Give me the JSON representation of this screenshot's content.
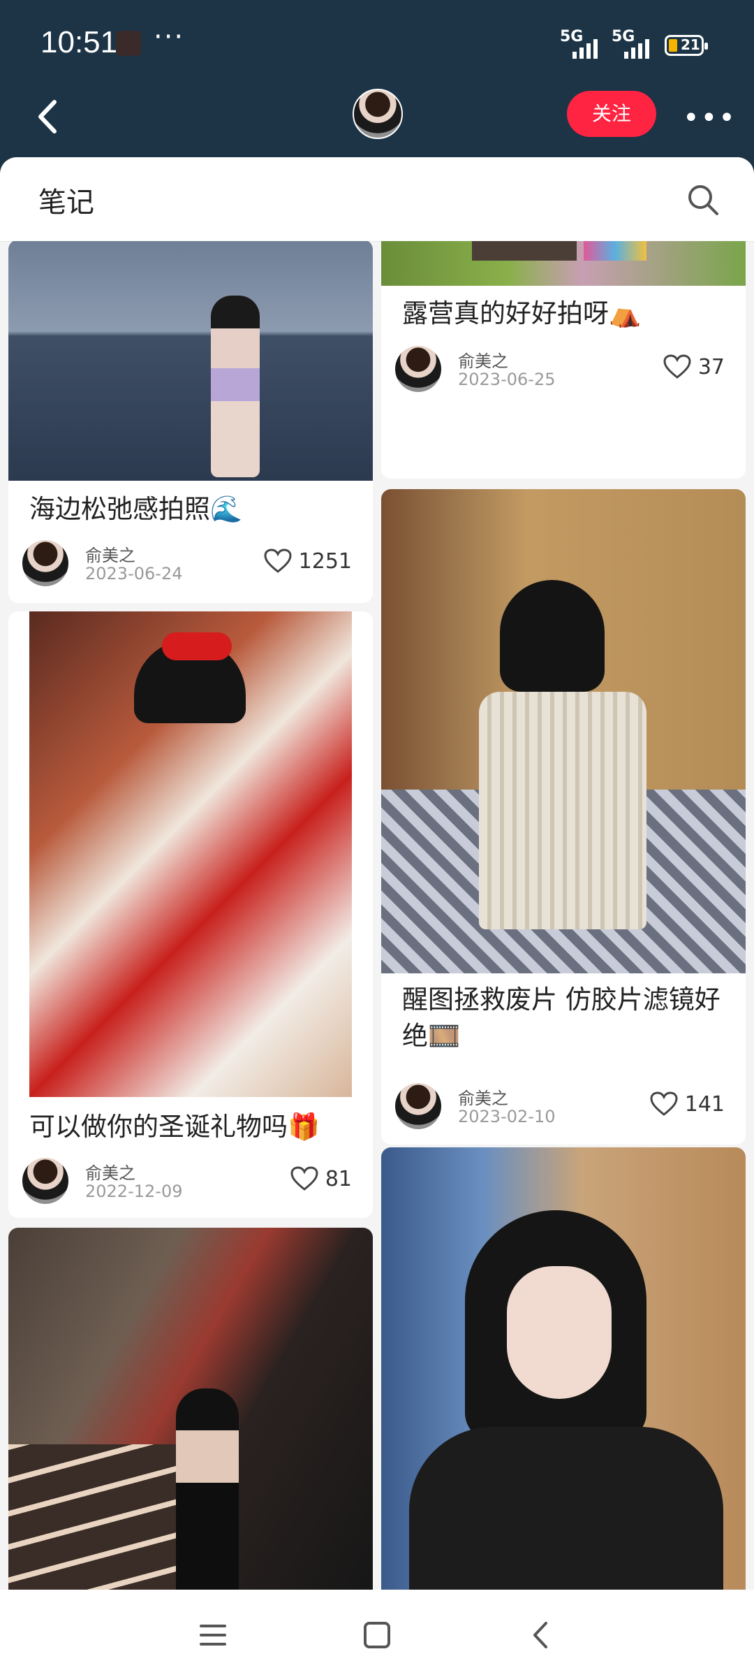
{
  "status_bar": {
    "time": "10:51",
    "network_1": "5G",
    "network_2": "5G",
    "battery": "21"
  },
  "top_bar": {
    "follow_label": "关注"
  },
  "section": {
    "title": "笔记"
  },
  "notes": [
    {
      "title": "海边松弛感拍照🌊",
      "author": "俞美之",
      "date": "2023-06-24",
      "likes": "1251"
    },
    {
      "title": "可以做你的圣诞礼物吗🎁",
      "author": "俞美之",
      "date": "2022-12-09",
      "likes": "81"
    },
    {
      "title": "露营真的好好拍呀⛺",
      "author": "俞美之",
      "date": "2023-06-25",
      "likes": "37"
    },
    {
      "title": "醒图拯救废片 仿胶片滤镜好绝🎞️",
      "author": "俞美之",
      "date": "2023-02-10",
      "likes": "141"
    }
  ]
}
